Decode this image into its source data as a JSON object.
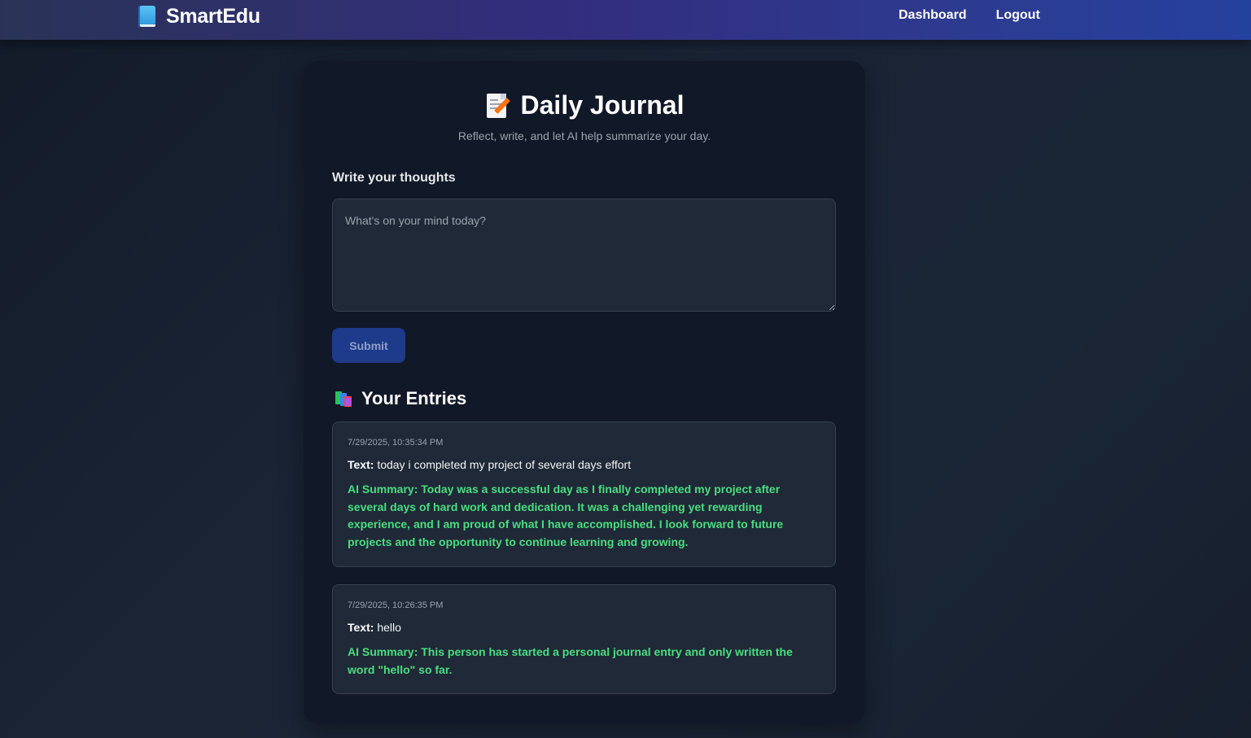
{
  "nav": {
    "brand": "SmartEdu",
    "brand_icon": "blue-book-icon",
    "links": [
      "Dashboard",
      "Logout"
    ]
  },
  "header": {
    "title": "Daily Journal",
    "title_icon": "memo-icon",
    "subtitle": "Reflect, write, and let AI help summarize your day."
  },
  "form": {
    "label": "Write your thoughts",
    "placeholder": "What's on your mind today?",
    "value": "",
    "submit_label": "Submit"
  },
  "entries_section": {
    "title": "Your Entries",
    "icon": "books-icon",
    "text_label": "Text:",
    "summary_label": "AI Summary:",
    "entries": [
      {
        "timestamp": "7/29/2025, 10:35:34 PM",
        "text": "today i completed my project of several days effort",
        "summary": "Today was a successful day as I finally completed my project after several days of hard work and dedication. It was a challenging yet rewarding experience, and I am proud of what I have accomplished. I look forward to future projects and the opportunity to continue learning and growing."
      },
      {
        "timestamp": "7/29/2025, 10:26:35 PM",
        "text": "hello",
        "summary": "This person has started a personal journal entry and only written the word \"hello\" so far."
      }
    ]
  },
  "colors": {
    "navbar_gradient_start": "#2a3357",
    "navbar_gradient_end": "#25419e",
    "card_bg": "#111827",
    "entry_bg": "#1f2937",
    "summary_green": "#4ade80",
    "submit_bg": "#1e3a8a"
  }
}
